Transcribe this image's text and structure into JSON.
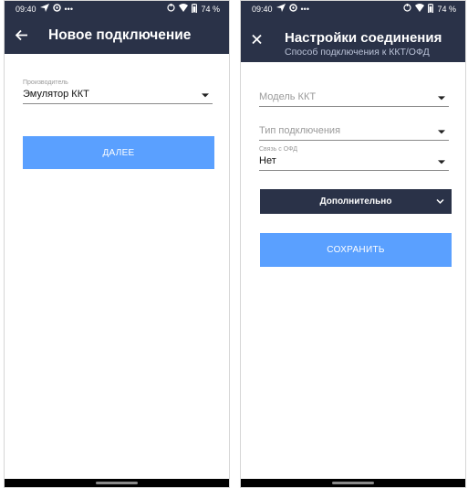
{
  "left_screen": {
    "status": {
      "time": "09:40",
      "dots": "•••",
      "battery": "74 %"
    },
    "appbar": {
      "title": "Новое подключение"
    },
    "manufacturer": {
      "label": "Производитель",
      "value": "Эмулятор ККТ"
    },
    "next_button": "ДАЛЕЕ"
  },
  "right_screen": {
    "status": {
      "time": "09:40",
      "dots": "•••",
      "battery": "74 %"
    },
    "appbar": {
      "title": "Настройки соединения",
      "subtitle": "Способ подключения к ККТ/ОФД"
    },
    "model": {
      "placeholder": "Модель ККТ"
    },
    "connection_type": {
      "placeholder": "Тип подключения"
    },
    "ofd_link": {
      "label": "Связь с ОФД",
      "value": "Нет"
    },
    "additional_button": "Дополнительно",
    "save_button": "СОХРАНИТЬ"
  },
  "colors": {
    "bar": "#2a3248",
    "accent": "#5aa0ff"
  },
  "icons": [
    "back-arrow-icon",
    "close-icon",
    "send-icon",
    "circle-icon",
    "wifi-icon",
    "battery-icon",
    "dropdown-caret-icon",
    "chevron-down-icon"
  ]
}
